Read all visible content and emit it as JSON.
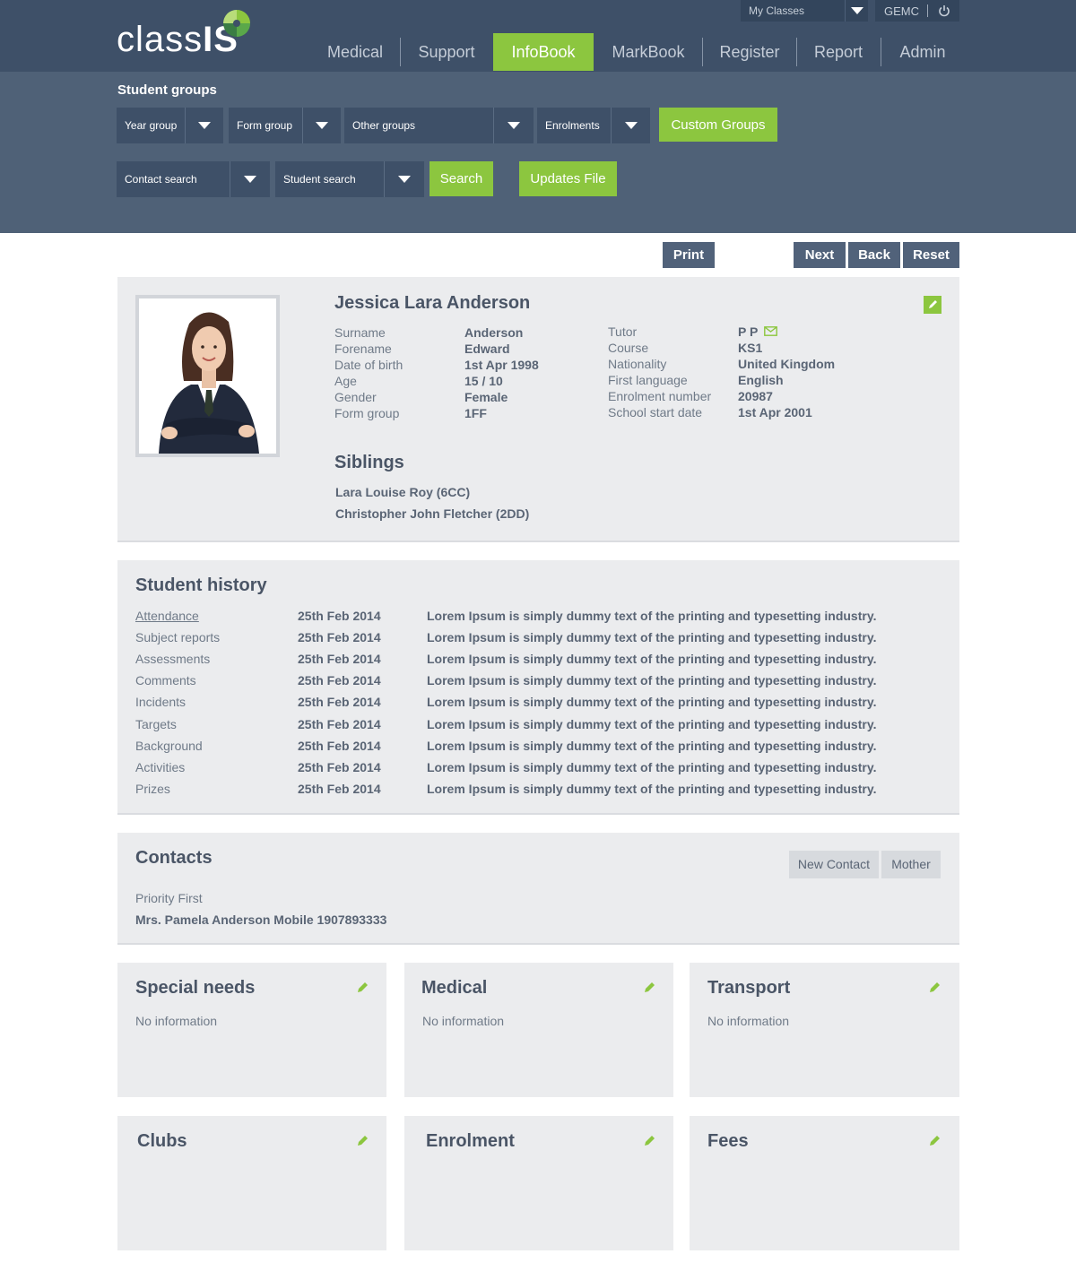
{
  "app": {
    "logo_text": "class",
    "logo_text_suffix": "IS",
    "my_classes_label": "My Classes",
    "user_code": "GEMC"
  },
  "nav": {
    "medical": "Medical",
    "support": "Support",
    "infobook": "InfoBook",
    "markbook": "MarkBook",
    "register": "Register",
    "report": "Report",
    "admin": "Admin",
    "active": "InfoBook"
  },
  "filters": {
    "title": "Student groups",
    "year_group": "Year group",
    "form_group": "Form group",
    "other_groups": "Other groups",
    "enrolments": "Enrolments",
    "custom_groups": "Custom Groups",
    "contact_search": "Contact search",
    "student_search": "Student search",
    "search": "Search",
    "updates_file": "Updates File"
  },
  "actions": {
    "print": "Print",
    "next": "Next",
    "back": "Back",
    "reset": "Reset"
  },
  "student": {
    "name": "Jessica Lara Anderson",
    "left": [
      {
        "label": "Surname",
        "value": "Anderson"
      },
      {
        "label": "Forename",
        "value": "Edward"
      },
      {
        "label": "Date of birth",
        "value": "1st Apr 1998"
      },
      {
        "label": "Age",
        "value": "15 / 10"
      },
      {
        "label": "Gender",
        "value": "Female"
      },
      {
        "label": "Form group",
        "value": "1FF"
      }
    ],
    "right": [
      {
        "label": "Tutor",
        "value": "P P"
      },
      {
        "label": "Course",
        "value": "KS1"
      },
      {
        "label": "Nationality",
        "value": "United Kingdom"
      },
      {
        "label": "First language",
        "value": "English"
      },
      {
        "label": "Enrolment number",
        "value": "20987"
      },
      {
        "label": "School start date",
        "value": "1st Apr 2001"
      }
    ],
    "siblings_title": "Siblings",
    "siblings": [
      "Lara Louise Roy (6CC)",
      "Christopher John Fletcher (2DD)"
    ]
  },
  "history": {
    "title": "Student history",
    "rows": [
      {
        "label": "Attendance",
        "date": "25th Feb 2014",
        "text": "Lorem Ipsum is simply dummy text of the printing and typesetting industry."
      },
      {
        "label": "Subject reports",
        "date": "25th Feb 2014",
        "text": "Lorem Ipsum is simply dummy text of the printing and typesetting industry."
      },
      {
        "label": "Assessments",
        "date": "25th Feb 2014",
        "text": "Lorem Ipsum is simply dummy text of the printing and typesetting industry."
      },
      {
        "label": "Comments",
        "date": "25th Feb 2014",
        "text": "Lorem Ipsum is simply dummy text of the printing and typesetting industry."
      },
      {
        "label": "Incidents",
        "date": "25th Feb 2014",
        "text": "Lorem Ipsum is simply dummy text of the printing and typesetting industry."
      },
      {
        "label": "Targets",
        "date": "25th Feb 2014",
        "text": "Lorem Ipsum is simply dummy text of the printing and typesetting industry."
      },
      {
        "label": "Background",
        "date": "25th Feb 2014",
        "text": "Lorem Ipsum is simply dummy text of the printing and typesetting industry."
      },
      {
        "label": "Activities",
        "date": "25th Feb 2014",
        "text": "Lorem Ipsum is simply dummy text of the printing and typesetting industry."
      },
      {
        "label": "Prizes",
        "date": "25th Feb 2014",
        "text": "Lorem Ipsum is simply dummy text of the printing and typesetting industry."
      }
    ]
  },
  "contacts": {
    "title": "Contacts",
    "new_contact": "New Contact",
    "mother": "Mother",
    "priority": "Priority First",
    "detail": "Mrs. Pamela Anderson Mobile 1907893333"
  },
  "cards": {
    "special_needs": {
      "title": "Special needs",
      "text": "No information"
    },
    "medical": {
      "title": "Medical",
      "text": "No information"
    },
    "transport": {
      "title": "Transport",
      "text": "No information"
    },
    "clubs": {
      "title": "Clubs"
    },
    "enrolment": {
      "title": "Enrolment"
    },
    "fees": {
      "title": "Fees"
    }
  },
  "colors": {
    "header": "#3e5068",
    "band": "#4f6177",
    "accent": "#8cc63f",
    "panel": "#ebecee"
  }
}
